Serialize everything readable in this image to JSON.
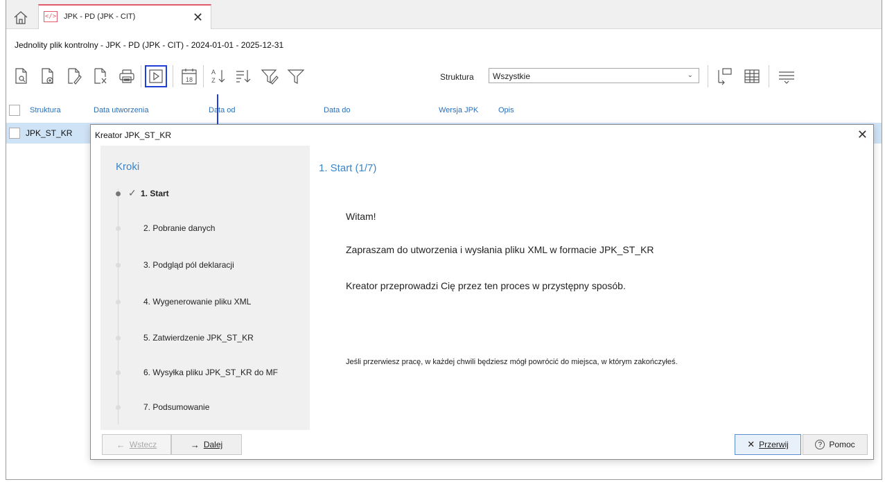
{
  "tab": {
    "icon_text": "</>",
    "label": "JPK - PD (JPK - CIT)",
    "close": "✕"
  },
  "subtitle": "Jednolity plik kontrolny - JPK - PD (JPK - CIT) - 2024-01-01 - 2025-12-31",
  "toolbar": {
    "struktura_label": "Struktura",
    "struktura_value": "Wszystkie",
    "calendar_num": "18",
    "sort_az_top": "A",
    "sort_az_bottom": "Z"
  },
  "grid": {
    "columns": [
      "Struktura",
      "Data utworzenia",
      "Data od",
      "Data do",
      "Wersja JPK",
      "Opis"
    ],
    "rows": [
      {
        "struktura": "JPK_ST_KR"
      }
    ]
  },
  "modal": {
    "title": "Kreator JPK_ST_KR",
    "close": "✕",
    "steps_title": "Kroki",
    "active_check": "✓",
    "steps": [
      "1. Start",
      "2. Pobranie danych",
      "3. Podgląd pól deklaracji",
      "4. Wygenerowanie pliku XML",
      "5. Zatwierdzenie JPK_ST_KR",
      "6. Wysyłka pliku JPK_ST_KR do MF",
      "7. Podsumowanie"
    ],
    "content_title": "1. Start (1/7)",
    "paragraphs": [
      "Witam!",
      "Zapraszam do utworzenia i wysłania pliku XML w formacie JPK_ST_KR",
      "Kreator przeprowadzi Cię przez ten proces w przystępny sposób."
    ],
    "note": "Jeśli przerwiesz pracę, w każdej chwili będziesz mógł powrócić do miejsca, w którym zakończyłeś.",
    "buttons": {
      "back": "Wstecz",
      "back_icon": "←",
      "next": "Dalej",
      "next_icon": "→",
      "cancel": "Przerwij",
      "cancel_icon": "✕",
      "help": "Pomoc",
      "help_icon": "?"
    }
  }
}
